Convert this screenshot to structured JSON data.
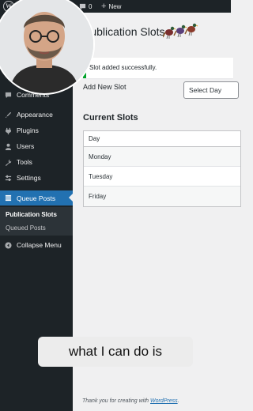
{
  "adminbar": {
    "comments_count": "0",
    "new_label": "New"
  },
  "sidebar": {
    "items": [
      {
        "label": "Comments",
        "icon": "comment-icon"
      },
      {
        "label": "Appearance",
        "icon": "brush-icon"
      },
      {
        "label": "Plugins",
        "icon": "plug-icon"
      },
      {
        "label": "Users",
        "icon": "user-icon"
      },
      {
        "label": "Tools",
        "icon": "wrench-icon"
      },
      {
        "label": "Settings",
        "icon": "settings-icon"
      },
      {
        "label": "Queue Posts",
        "icon": "queue-icon"
      }
    ],
    "submenu": [
      "Publication Slots",
      "Queued Posts"
    ],
    "collapse_label": "Collapse Menu"
  },
  "page": {
    "title": "Publication Slots",
    "notice": "Slot added successfully.",
    "add_label": "Add New Slot",
    "select_value": "Select Day",
    "current_heading": "Current Slots",
    "table_header": "Day",
    "days": [
      "Monday",
      "Tuesday",
      "Friday"
    ],
    "footer_prefix": "Thank you for creating with",
    "footer_link": "WordPress",
    "footer_suffix": "."
  },
  "video": {
    "caption": "what I can do is"
  },
  "colors": {
    "accent": "#2271b1",
    "sidebar": "#1d2327",
    "notice": "#00a32a"
  }
}
